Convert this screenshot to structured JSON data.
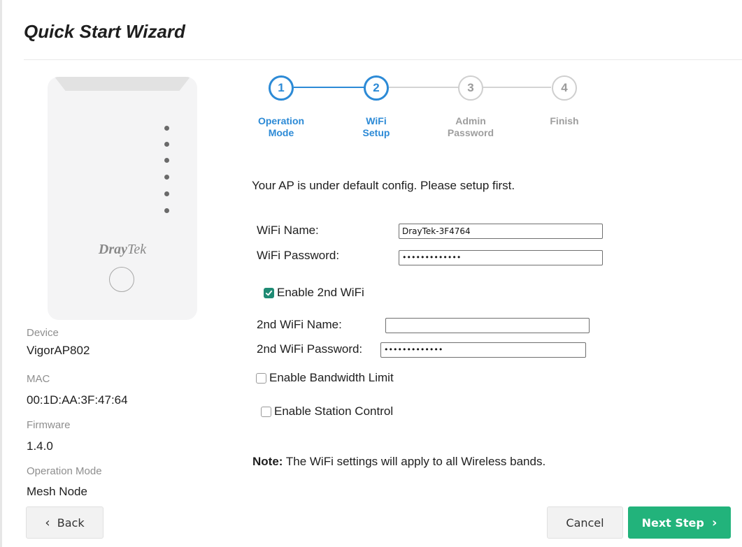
{
  "page": {
    "title": "Quick Start Wizard"
  },
  "device_image": {
    "brand_bold": "Dray",
    "brand_light": "Tek"
  },
  "device_info": {
    "device_label": "Device",
    "device_value": "VigorAP802",
    "mac_label": "MAC",
    "mac_value": "00:1D:AA:3F:47:64",
    "firmware_label": "Firmware",
    "firmware_value": "1.4.0",
    "mode_label": "Operation Mode",
    "mode_value": "Mesh Node"
  },
  "stepper": {
    "current_step": 2,
    "steps": [
      {
        "number": "1",
        "line1": "Operation",
        "line2": "Mode"
      },
      {
        "number": "2",
        "line1": "WiFi",
        "line2": "Setup"
      },
      {
        "number": "3",
        "line1": "Admin",
        "line2": "Password"
      },
      {
        "number": "4",
        "line1": "Finish",
        "line2": ""
      }
    ]
  },
  "form": {
    "intro": "Your AP is under default config. Please setup first.",
    "wifi_name_label": "WiFi Name:",
    "wifi_name_value": "DrayTek-3F4764",
    "wifi_password_label": "WiFi Password:",
    "wifi_password_value": "•••••••••••••",
    "enable_2nd_wifi_label": "Enable 2nd WiFi",
    "enable_2nd_wifi_checked": true,
    "second_wifi_name_label": "2nd WiFi Name:",
    "second_wifi_name_value": "",
    "second_wifi_password_label": "2nd WiFi Password:",
    "second_wifi_password_value": "•••••••••••••",
    "bandwidth_limit_label": "Enable Bandwidth Limit",
    "bandwidth_limit_checked": false,
    "station_control_label": "Enable Station Control",
    "station_control_checked": false,
    "note_bold": "Note:",
    "note_text": " The WiFi settings will apply to all Wireless bands."
  },
  "buttons": {
    "back": "Back",
    "cancel": "Cancel",
    "next": "Next Step"
  },
  "colors": {
    "accent": "#2c8ad6",
    "primary_button": "#22b37b",
    "checkbox": "#1f8b74"
  }
}
